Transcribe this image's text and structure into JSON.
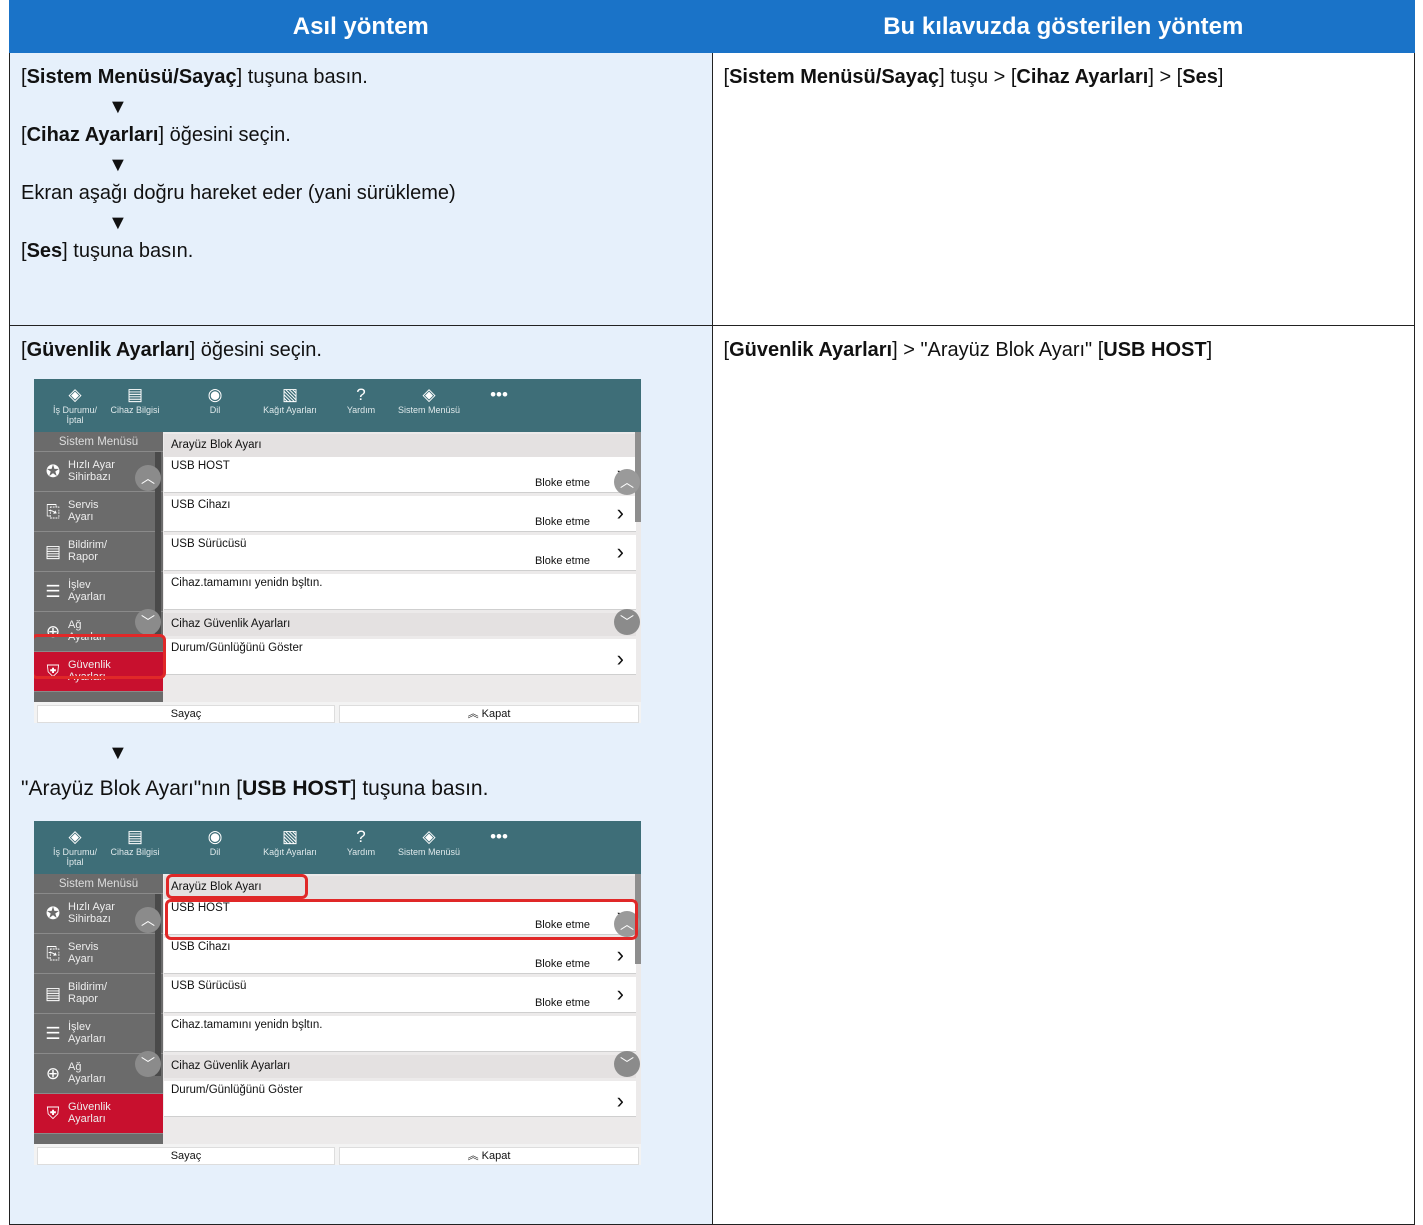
{
  "headers": {
    "left": "Asıl yöntem",
    "right": "Bu kılavuzda gösterilen yöntem"
  },
  "row1": {
    "step1": {
      "pre": "[",
      "bold": "Sistem Menüsü/Sayaç",
      "post": "] tuşuna basın."
    },
    "step2": {
      "pre": "[",
      "bold": "Cihaz Ayarları",
      "post": "] öğesini seçin."
    },
    "step3": "Ekran aşağı doğru hareket eder (yani sürükleme)",
    "step4": {
      "pre": "[",
      "bold": "Ses",
      "post": "] tuşuna basın."
    },
    "arrow": "▼",
    "right": {
      "p1": "[",
      "b1": "Sistem Menüsü/Sayaç",
      "p2": "] tuşu > [",
      "b2": "Cihaz Ayarları",
      "p3": "] > [",
      "b3": "Ses",
      "p4": "]"
    }
  },
  "row2": {
    "step1": {
      "pre": "[",
      "bold": "Güvenlik Ayarları",
      "post": "] öğesini seçin."
    },
    "step2": {
      "pre": "\"Arayüz Blok Ayarı\"nın [",
      "bold": "USB HOST",
      "post": "] tuşuna basın."
    },
    "arrow": "▼",
    "right": {
      "p1": "[",
      "b1": "Güvenlik Ayarları",
      "p2": "] > \"Arayüz Blok Ayarı\" [",
      "b2": "USB HOST",
      "p3": "]"
    }
  },
  "panel": {
    "topbar": [
      {
        "icon": "eye-icon",
        "glyph": "◈",
        "label": "İş Durumu/\nİptal"
      },
      {
        "icon": "device-icon",
        "glyph": "▤",
        "label": "Cihaz Bilgisi"
      },
      {
        "icon": "language-icon",
        "glyph": "◉",
        "label": "Dil"
      },
      {
        "icon": "paper-icon",
        "glyph": "▧",
        "label": "Kağıt Ayarları"
      },
      {
        "icon": "help-icon",
        "glyph": "?",
        "label": "Yardım"
      },
      {
        "icon": "system-menu-icon",
        "glyph": "◈",
        "label": "Sistem Menüsü"
      },
      {
        "icon": "more-icon",
        "glyph": "•••",
        "label": ""
      }
    ],
    "sidebar_title": "Sistem Menüsü",
    "sidebar_items": [
      {
        "icon": "wizard-icon",
        "glyph": "✪",
        "label": "Hızlı Ayar\nSihirbazı"
      },
      {
        "icon": "service-icon",
        "glyph": "⎘",
        "label": "Servis\nAyarı"
      },
      {
        "icon": "report-icon",
        "glyph": "▤",
        "label": "Bildirim/\nRapor"
      },
      {
        "icon": "function-list-icon",
        "glyph": "☰",
        "label": "İşlev\nAyarları"
      },
      {
        "icon": "network-icon",
        "glyph": "⊕",
        "label": "Ağ\nAyarları"
      },
      {
        "icon": "security-icon",
        "glyph": "⛨",
        "label": "Güvenlik\nAyarları"
      }
    ],
    "section1": "Arayüz Blok Ayarı",
    "rows": [
      {
        "name": "USB HOST",
        "value": "Bloke etme"
      },
      {
        "name": "USB Cihazı",
        "value": "Bloke etme"
      },
      {
        "name": "USB Sürücüsü",
        "value": "Bloke etme"
      }
    ],
    "restart_text": "Cihaz.tamamını yenidn bşltın.",
    "section2": "Cihaz Güvenlik Ayarları",
    "status_row": "Durum/Günlüğünü Göster",
    "counter_btn": "Sayaç",
    "close_btn": "Kapat",
    "colors": {
      "topbar": "#3e6e78",
      "sidebar": "#6b6b6b",
      "selected": "#c8102e",
      "highlight": "#e02828"
    }
  },
  "colors": {
    "header": "#1a73c8",
    "left_cell": "#e6f0fb"
  }
}
